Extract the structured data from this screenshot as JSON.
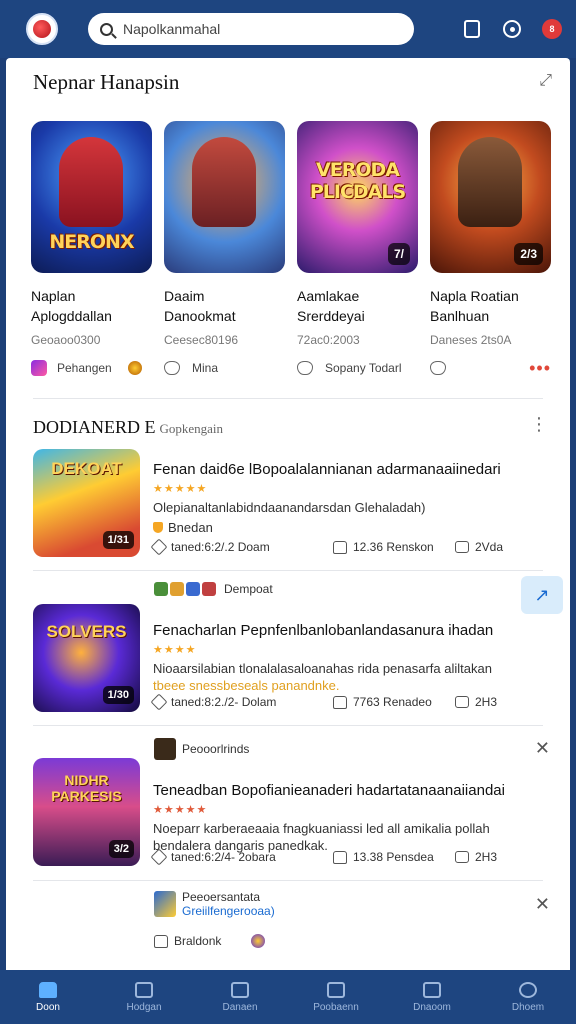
{
  "header": {
    "search_value": "Napolkanmahal",
    "notif_count": "8"
  },
  "featured": {
    "title": "Nepnar Hanapsin",
    "cards": [
      {
        "art": "NERONX",
        "line1": "Naplan",
        "line2": "Aplogddallan",
        "meta": "Geoaoo0300",
        "foot": "Pehangen",
        "badge": ""
      },
      {
        "art": "",
        "line1": "Daaim",
        "line2": "Danookmat",
        "meta": "Ceesec80196",
        "foot": "Mina",
        "badge": ""
      },
      {
        "art": "VERODA PLICDALS",
        "line1": "Aamlakae",
        "line2": "Srerddeyai",
        "meta": "72ac0:2003",
        "foot": "Sopany Todarl",
        "badge": "7/"
      },
      {
        "art": "",
        "line1": "Napla Roatian",
        "line2": "Banlhuan",
        "meta": "Daneses 2ts0A",
        "foot": "",
        "badge": "2/3"
      }
    ]
  },
  "feed": {
    "title": "DODIANERD E",
    "subtitle": "Gopkengain",
    "posts": [
      {
        "art": "DEKOAT",
        "badge": "1/31",
        "title": "Fenan daid6e lBopoalalannianan adarmanaaiinedari",
        "stars": "★★★★★",
        "desc": "Olepianaltanlabidndaanandarsdan Glehaladah)",
        "tag": "Bnedan",
        "a1": "taned:6:2/.2 Doam",
        "a2": "12.36 Renskon",
        "a3": "2Vda"
      },
      {
        "art": "SOLVERS",
        "badge": "1/30",
        "title": "Fenacharlan Pepnfenlbanlobanlandasanura ihadan",
        "stars": "★★★★",
        "desc": "Nioaarsilabian tlonalalasaloanahas rida penasarfa aliltakan",
        "desc2": "tbeee snessbeseals panandnke.",
        "a1": "taned:8:2./2- Dolam",
        "a2": "7763 Renadeo",
        "a3": "2H3"
      },
      {
        "art": "NIDHR PARKESIS",
        "badge": "3/2",
        "title": "Teneadban Bopofianieanaderi hadartatanaanaiiandai",
        "stars": "★★★★★",
        "desc": "Noeparr karberaeaaia fnagkuaniassi led all amikalia pollah",
        "desc2": "bendalera dangaris panedkak.",
        "a1": "taned:6:2/4- 2obara",
        "a2": "13.38 Pensdea",
        "a3": "2H3"
      }
    ],
    "rows": {
      "r1_label": "Dempoat",
      "r2_label": "Peooorlrinds",
      "r3_name": "Peeoersantata",
      "r3_handle": "Greiilfengerooaa)",
      "r3_action": "Braldonk"
    }
  },
  "nav": {
    "items": [
      "Doon",
      "Hodgan",
      "Danaen",
      "Poobaenn",
      "Dnaoom",
      "Dhoem"
    ]
  }
}
